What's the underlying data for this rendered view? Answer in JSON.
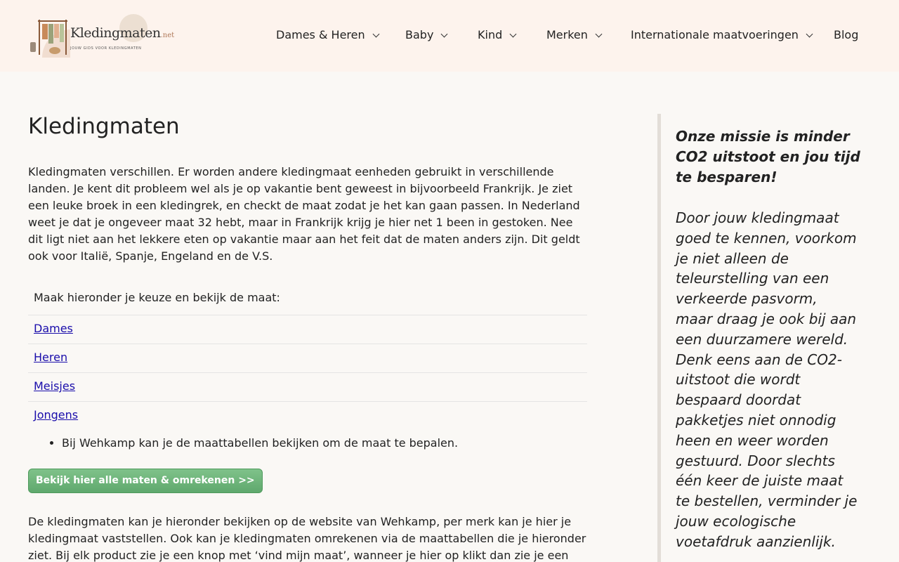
{
  "header": {
    "logo": {
      "name": "Kledingmaten",
      "suffix": ".net",
      "tagline": "JOUW GIDS VOOR KLEDINGMATEN"
    },
    "nav": [
      {
        "label": "Dames & Heren",
        "has_dropdown": true
      },
      {
        "label": "Baby",
        "has_dropdown": true
      },
      {
        "label": "Kind",
        "has_dropdown": true
      },
      {
        "label": "Merken",
        "has_dropdown": true
      },
      {
        "label": "Internationale maatvoeringen",
        "has_dropdown": true
      },
      {
        "label": "Blog",
        "has_dropdown": false
      }
    ]
  },
  "main": {
    "title": "Kledingmaten",
    "intro": "Kledingmaten verschillen. Er worden andere kledingmaat eenheden gebruikt in verschillende landen. Je kent dit probleem wel als je op vakantie bent geweest in bijvoorbeeld Frankrijk. Je ziet een leuke broek in een kledingrek, en checkt de maat zodat je het kan gaan passen. In Nederland weet je dat je ongeveer maat 32 hebt, maar in Frankrijk krijg je hier net 1 been in gestoken. Nee dit ligt niet aan het lekkere eten op vakantie maar aan het feit dat de maten anders zijn. Dit geldt ook voor Italië, Spanje, Engeland en de V.S.",
    "choice_heading": "Maak hieronder je keuze en bekijk de maat:",
    "choices": [
      "Dames",
      "Heren",
      "Meisjes",
      "Jongens"
    ],
    "bullets": [
      "Bij Wehkamp kan je de maattabellen bekijken om de maat te bepalen."
    ],
    "cta_label": "Bekijk hier alle maten & omrekenen >>",
    "outro": "De kledingmaten kan je hieronder bekijken op de website van Wehkamp, per merk kan je hier je kledingmaat vaststellen. Ook kan je kledingmaten omrekenen via de maattabellen die je hieronder ziet. Bij elk product zie je een knop met ‘vind mijn maat’, wanneer je hier op klikt dan zie je een"
  },
  "sidebar": {
    "title": "Onze missie is minder CO2 uitstoot en jou tijd te besparen!",
    "body": "Door jouw kledingmaat goed te kennen, voorkom je niet alleen de teleurstelling van een verkeerde pasvorm, maar draag je ook bij aan een duurzamere wereld. Denk eens aan de CO2-uitstoot die wordt bespaard doordat pakketjes niet onnodig heen en weer worden gestuurd. Door slechts één keer de juiste maat te bestellen, verminder je jouw ecologische voetafdruk aanzienlijk."
  },
  "colors": {
    "header_bg": "#fdf3ed",
    "page_bg": "#faf8f5",
    "link": "#1a0dab",
    "cta": "#6cb278"
  }
}
